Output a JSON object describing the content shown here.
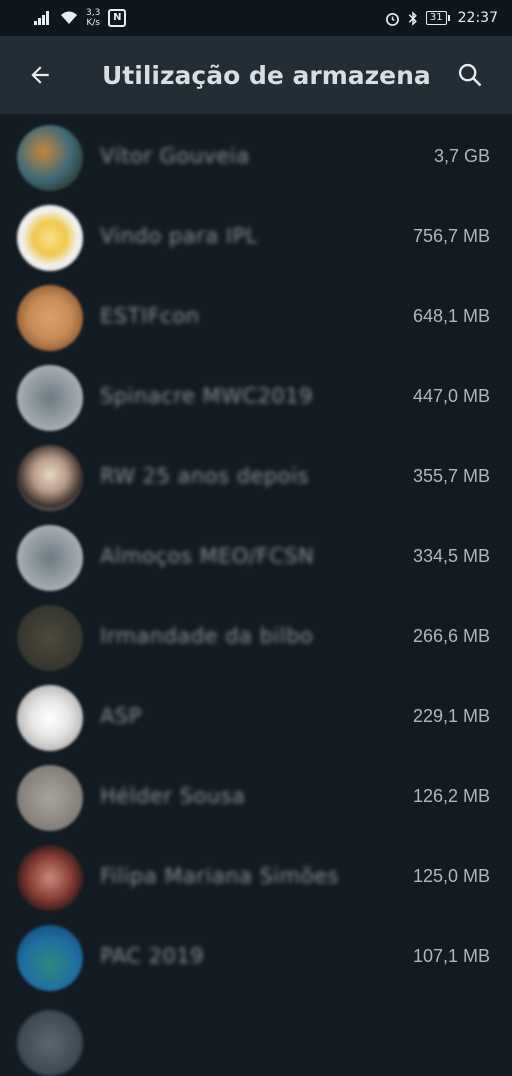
{
  "status_bar": {
    "net_speed_value": "3,3",
    "net_speed_unit": "K/s",
    "nfc_label": "N",
    "battery_level": "31",
    "time": "22:37"
  },
  "app_bar": {
    "title": "Utilização de armazenamento"
  },
  "colors": {
    "background": "#121b22",
    "app_bar": "#232d36",
    "text_secondary": "#aeb7bb"
  },
  "chats": [
    {
      "name": "Vítor Gouveia",
      "size": "3,7 GB"
    },
    {
      "name": "Vindo para IPL",
      "size": "756,7 MB"
    },
    {
      "name": "ESTIFcon",
      "size": "648,1 MB"
    },
    {
      "name": "Spinacre MWC2019",
      "size": "447,0 MB"
    },
    {
      "name": "RW 25 anos depois",
      "size": "355,7 MB"
    },
    {
      "name": "Almoços MEO/FCSN",
      "size": "334,5 MB"
    },
    {
      "name": "Irmandade da bilbo",
      "size": "266,6 MB"
    },
    {
      "name": "ASP",
      "size": "229,1 MB"
    },
    {
      "name": "Hélder Sousa",
      "size": "126,2 MB"
    },
    {
      "name": "Filipa Mariana Simões",
      "size": "125,0 MB"
    },
    {
      "name": "PAC 2019",
      "size": "107,1 MB"
    }
  ]
}
